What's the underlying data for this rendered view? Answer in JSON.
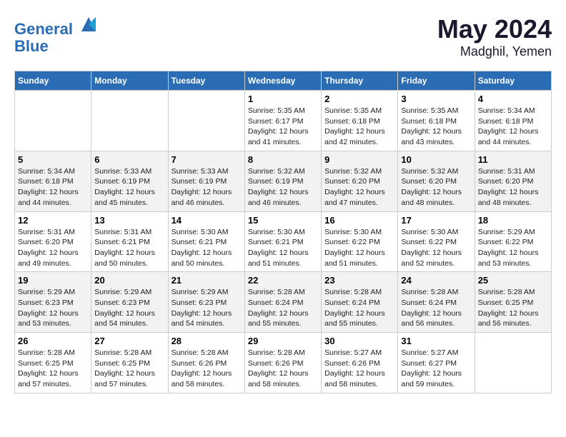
{
  "header": {
    "logo_line1": "General",
    "logo_line2": "Blue",
    "month": "May 2024",
    "location": "Madghil, Yemen"
  },
  "weekdays": [
    "Sunday",
    "Monday",
    "Tuesday",
    "Wednesday",
    "Thursday",
    "Friday",
    "Saturday"
  ],
  "weeks": [
    [
      {
        "day": "",
        "info": ""
      },
      {
        "day": "",
        "info": ""
      },
      {
        "day": "",
        "info": ""
      },
      {
        "day": "1",
        "info": "Sunrise: 5:35 AM\nSunset: 6:17 PM\nDaylight: 12 hours\nand 41 minutes."
      },
      {
        "day": "2",
        "info": "Sunrise: 5:35 AM\nSunset: 6:18 PM\nDaylight: 12 hours\nand 42 minutes."
      },
      {
        "day": "3",
        "info": "Sunrise: 5:35 AM\nSunset: 6:18 PM\nDaylight: 12 hours\nand 43 minutes."
      },
      {
        "day": "4",
        "info": "Sunrise: 5:34 AM\nSunset: 6:18 PM\nDaylight: 12 hours\nand 44 minutes."
      }
    ],
    [
      {
        "day": "5",
        "info": "Sunrise: 5:34 AM\nSunset: 6:18 PM\nDaylight: 12 hours\nand 44 minutes."
      },
      {
        "day": "6",
        "info": "Sunrise: 5:33 AM\nSunset: 6:19 PM\nDaylight: 12 hours\nand 45 minutes."
      },
      {
        "day": "7",
        "info": "Sunrise: 5:33 AM\nSunset: 6:19 PM\nDaylight: 12 hours\nand 46 minutes."
      },
      {
        "day": "8",
        "info": "Sunrise: 5:32 AM\nSunset: 6:19 PM\nDaylight: 12 hours\nand 46 minutes."
      },
      {
        "day": "9",
        "info": "Sunrise: 5:32 AM\nSunset: 6:20 PM\nDaylight: 12 hours\nand 47 minutes."
      },
      {
        "day": "10",
        "info": "Sunrise: 5:32 AM\nSunset: 6:20 PM\nDaylight: 12 hours\nand 48 minutes."
      },
      {
        "day": "11",
        "info": "Sunrise: 5:31 AM\nSunset: 6:20 PM\nDaylight: 12 hours\nand 48 minutes."
      }
    ],
    [
      {
        "day": "12",
        "info": "Sunrise: 5:31 AM\nSunset: 6:20 PM\nDaylight: 12 hours\nand 49 minutes."
      },
      {
        "day": "13",
        "info": "Sunrise: 5:31 AM\nSunset: 6:21 PM\nDaylight: 12 hours\nand 50 minutes."
      },
      {
        "day": "14",
        "info": "Sunrise: 5:30 AM\nSunset: 6:21 PM\nDaylight: 12 hours\nand 50 minutes."
      },
      {
        "day": "15",
        "info": "Sunrise: 5:30 AM\nSunset: 6:21 PM\nDaylight: 12 hours\nand 51 minutes."
      },
      {
        "day": "16",
        "info": "Sunrise: 5:30 AM\nSunset: 6:22 PM\nDaylight: 12 hours\nand 51 minutes."
      },
      {
        "day": "17",
        "info": "Sunrise: 5:30 AM\nSunset: 6:22 PM\nDaylight: 12 hours\nand 52 minutes."
      },
      {
        "day": "18",
        "info": "Sunrise: 5:29 AM\nSunset: 6:22 PM\nDaylight: 12 hours\nand 53 minutes."
      }
    ],
    [
      {
        "day": "19",
        "info": "Sunrise: 5:29 AM\nSunset: 6:23 PM\nDaylight: 12 hours\nand 53 minutes."
      },
      {
        "day": "20",
        "info": "Sunrise: 5:29 AM\nSunset: 6:23 PM\nDaylight: 12 hours\nand 54 minutes."
      },
      {
        "day": "21",
        "info": "Sunrise: 5:29 AM\nSunset: 6:23 PM\nDaylight: 12 hours\nand 54 minutes."
      },
      {
        "day": "22",
        "info": "Sunrise: 5:28 AM\nSunset: 6:24 PM\nDaylight: 12 hours\nand 55 minutes."
      },
      {
        "day": "23",
        "info": "Sunrise: 5:28 AM\nSunset: 6:24 PM\nDaylight: 12 hours\nand 55 minutes."
      },
      {
        "day": "24",
        "info": "Sunrise: 5:28 AM\nSunset: 6:24 PM\nDaylight: 12 hours\nand 56 minutes."
      },
      {
        "day": "25",
        "info": "Sunrise: 5:28 AM\nSunset: 6:25 PM\nDaylight: 12 hours\nand 56 minutes."
      }
    ],
    [
      {
        "day": "26",
        "info": "Sunrise: 5:28 AM\nSunset: 6:25 PM\nDaylight: 12 hours\nand 57 minutes."
      },
      {
        "day": "27",
        "info": "Sunrise: 5:28 AM\nSunset: 6:25 PM\nDaylight: 12 hours\nand 57 minutes."
      },
      {
        "day": "28",
        "info": "Sunrise: 5:28 AM\nSunset: 6:26 PM\nDaylight: 12 hours\nand 58 minutes."
      },
      {
        "day": "29",
        "info": "Sunrise: 5:28 AM\nSunset: 6:26 PM\nDaylight: 12 hours\nand 58 minutes."
      },
      {
        "day": "30",
        "info": "Sunrise: 5:27 AM\nSunset: 6:26 PM\nDaylight: 12 hours\nand 58 minutes."
      },
      {
        "day": "31",
        "info": "Sunrise: 5:27 AM\nSunset: 6:27 PM\nDaylight: 12 hours\nand 59 minutes."
      },
      {
        "day": "",
        "info": ""
      }
    ]
  ]
}
